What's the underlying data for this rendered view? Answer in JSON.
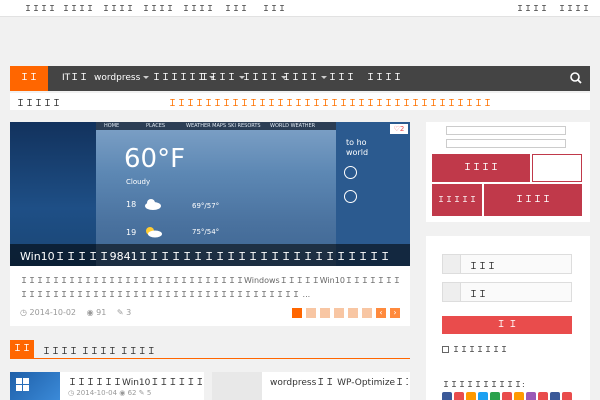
{
  "topbar": {
    "links": [
      "ＩＩＩＩ",
      "ＩＩＩＩ",
      "ＩＩＩＩ",
      "ＩＩＩＩ",
      "ＩＩＩＩ",
      "ＩＩＩ",
      "ＩＩＩ"
    ],
    "right_links": [
      "ＩＩＩＩ",
      "ＩＩＩＩ"
    ]
  },
  "nav": {
    "items": [
      {
        "label": "ＩＩ",
        "active": true,
        "caret": false
      },
      {
        "label": "ITＩＩ",
        "caret": false
      },
      {
        "label": "wordpress",
        "caret": true
      },
      {
        "label": "ＩＩＩＩＩＩ",
        "caret": true
      },
      {
        "label": "ＩＩＩＩ",
        "caret": true
      },
      {
        "label": "ＩＩＩＩ",
        "caret": true
      },
      {
        "label": "ＩＩＩＩ",
        "caret": true
      },
      {
        "label": "ＩＩＩ",
        "caret": false
      },
      {
        "label": "ＩＩＩＩ",
        "caret": false
      }
    ],
    "search_icon": "search-icon"
  },
  "ticker": {
    "label": "ＩＩＩＩＩ",
    "text": "ＩＩＩＩＩＩＩＩＩＩＩＩＩＩＩＩＩＩＩＩＩＩＩＩＩＩＩＩＩＩＩＩＩＩＩＩＩＩＩＩＩＩＩＩＩＩＩＩＩＩＩＩＩ"
  },
  "slider": {
    "caption": "Win10ＩＩＩＩＩ9841ＩＩＩＩＩＩＩＩＩＩＩＩＩＩＩＩＩＩＩＩＩＩＩ",
    "like_count": "2",
    "screen_tabs": [
      "HOME",
      "PLACES",
      "WEATHER MAPS",
      "SKI RESORTS",
      "WORLD WEATHER"
    ],
    "temp": "60°F",
    "condition": "Cloudy",
    "days": [
      {
        "day": "18",
        "range": "69°/57°"
      },
      {
        "day": "19",
        "range": "75°/54°"
      }
    ],
    "side_text": [
      "to ho",
      "world"
    ],
    "total_slides": 8,
    "active_slide": 1
  },
  "excerpt": {
    "text": "ＩＩＩＩＩＩＩＩＩＩＩＩＩＩＩＩＩＩＩＩＩＩＩＩＩＩＩＩWindowsＩＩＩＩＩWin10ＩＩＩＩＩＩＩＩＩＩＩＩＩＩＩＩＩＩＩＩＩＩＩＩＩＩＩＩＩＩＩＩＩＩＩＩＩＩＩＩＩＩ ...",
    "date": "2014-10-02",
    "views": "91",
    "comments": "3"
  },
  "section": {
    "tag": "ＩＩ",
    "title": "ＩＩＩＩ ＩＩＩＩ ＩＩＩＩ"
  },
  "cards": [
    {
      "title": "ＩＩＩＩＩＩWin10ＩＩＩＩＩＩＩＩＩＩＩＩＩＩＩ",
      "date": "2014-10-04",
      "views": "62",
      "comments": "5"
    },
    {
      "title": "wordpressＩＩ WP-OptimizeＩＩ ＩＩＩＩＩ",
      "date": "",
      "views": "",
      "comments": ""
    }
  ],
  "widget": {
    "tiles": [
      "ＩＩＩＩ",
      "ＩＩＩＩＩ",
      "ＩＩＩＩ"
    ]
  },
  "login": {
    "username_placeholder": "ＩＩＩ",
    "password_placeholder": "ＩＩ",
    "submit_label": "Ｉ Ｉ",
    "remember_label": "ＩＩＩＩＩＩＩ",
    "social_label": "ＩＩＩＩＩＩＩＩＩＩ:",
    "social_colors": [
      "#3b5998",
      "#e94c4c",
      "#ff9900",
      "#1da1f2",
      "#2aa14c",
      "#e94c4c",
      "#ff9900",
      "#9b59b6",
      "#e94c4c",
      "#3b5998",
      "#e94c4c"
    ]
  },
  "colors": {
    "accent": "#ff6600",
    "nav_bg": "#444444",
    "tile_red": "#c0394a",
    "button_red": "#e94c4c"
  }
}
